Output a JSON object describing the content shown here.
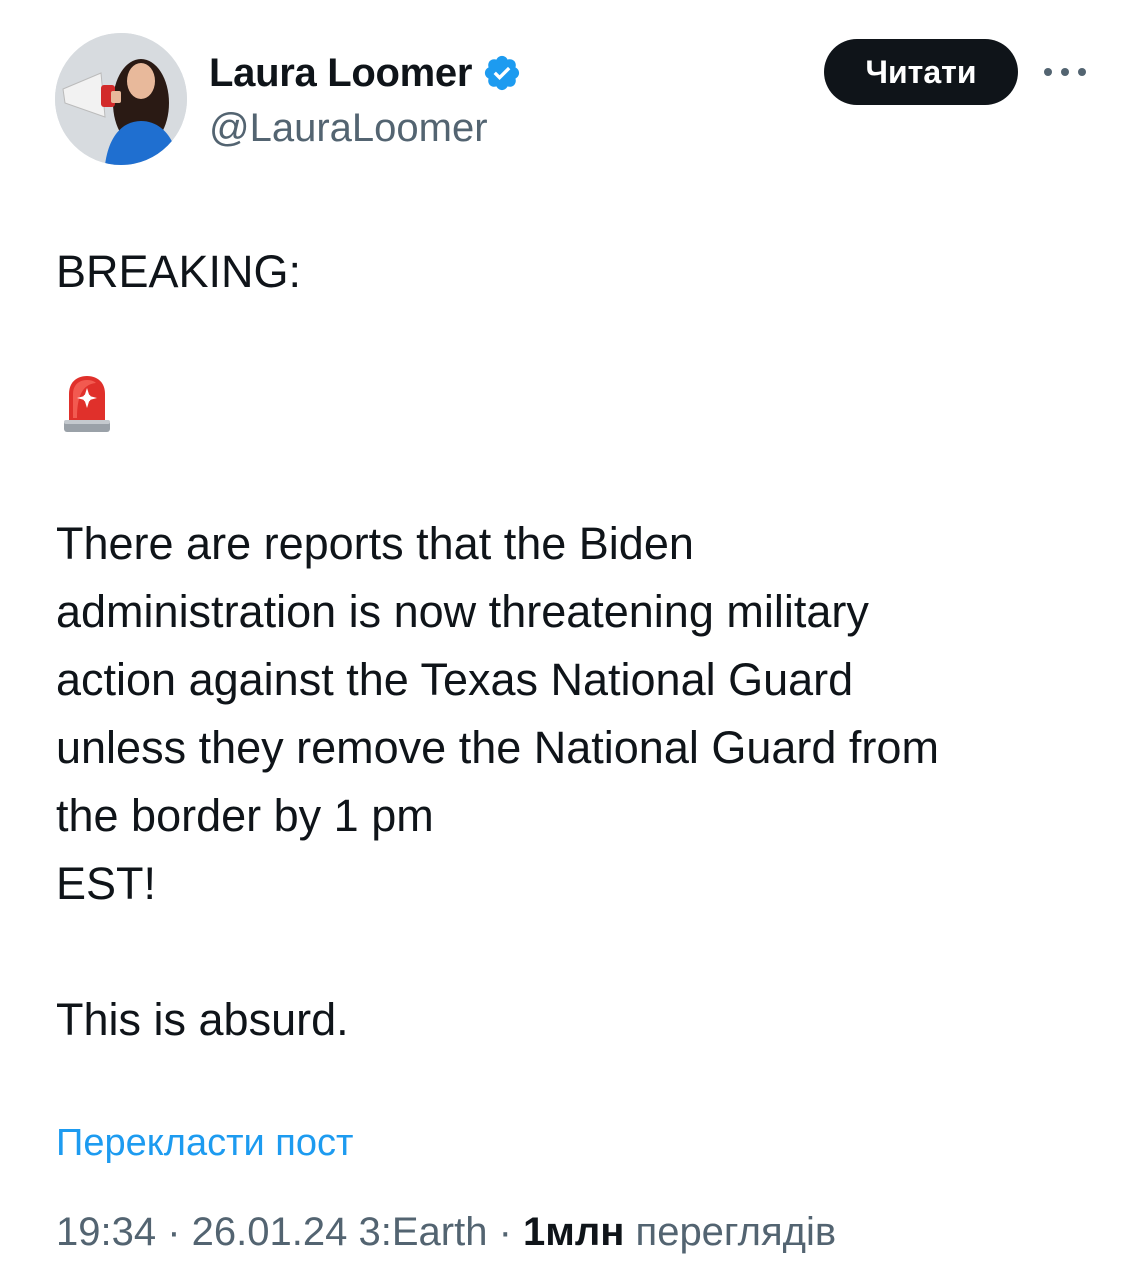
{
  "author": {
    "display_name": "Laura Loomer",
    "handle": "@LauraLoomer",
    "verified": true,
    "avatar_icon": "profile-photo-with-megaphone"
  },
  "follow_button": {
    "label": "Читати"
  },
  "more_menu": {
    "icon": "more-horizontal-icon"
  },
  "tweet": {
    "line1": "BREAKING:",
    "emoji": "🚨",
    "emoji_icon": "police-car-light-icon",
    "paragraph2": "There are reports that the Biden\nadministration is now threatening military\naction against the Texas National Guard\nunless they remove the National Guard from\nthe border by 1 pm\nEST!",
    "paragraph3": "This is absurd."
  },
  "translate_link": "Перекласти пост",
  "meta": {
    "time": "19:34",
    "date": "26.01.24",
    "source": "3:Earth",
    "separator": " · ",
    "views_count": "1млн",
    "views_label": "переглядів"
  },
  "colors": {
    "text_primary": "#0f1419",
    "text_secondary": "#536471",
    "link": "#1d9bf0",
    "verified_badge": "#1d9bf0"
  }
}
